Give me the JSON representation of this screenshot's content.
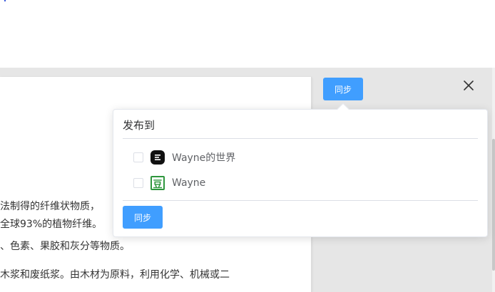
{
  "toolbar": {
    "sync_label": "同步"
  },
  "document": {
    "lines": [
      "法制得的纤维状物质，",
      "全球93%的植物纤维。",
      "、色素、果胶和灰分等物质。",
      "木浆和废纸浆。由木材为原料，利用化学、机械或二"
    ]
  },
  "popover": {
    "title": "发布到",
    "platforms": [
      {
        "name": "Wayne的世界",
        "icon": "jianshu-icon",
        "checked": false
      },
      {
        "name": "Wayne",
        "icon": "douban-icon",
        "glyph": "豆",
        "checked": false
      }
    ],
    "submit_label": "同步"
  },
  "colors": {
    "primary": "#409eff",
    "douban_green": "#2e963d",
    "jianshu_black": "#111111"
  }
}
